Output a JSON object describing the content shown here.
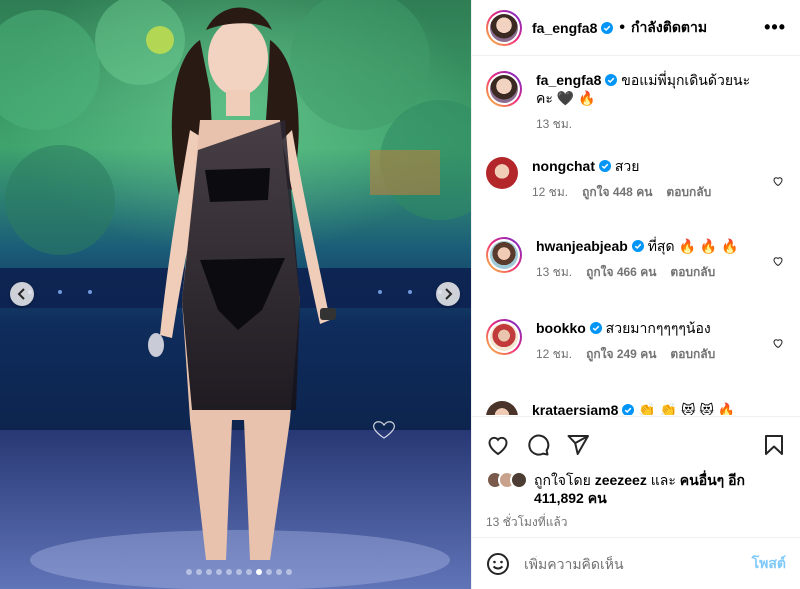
{
  "post_author": {
    "username": "fa_engfa8",
    "follow_status": "กำลังติดตาม",
    "separator": "•"
  },
  "caption": {
    "username": "fa_engfa8",
    "text": "ขอแม่พี่มุกเดินด้วยนะคะ 🖤 🔥",
    "time": "13 ชม."
  },
  "comments": [
    {
      "username": "nongchat",
      "text": "สวย",
      "time": "12 ชม.",
      "likes": "ถูกใจ 448 คน",
      "reply": "ตอบกลับ"
    },
    {
      "username": "hwanjeabjeab",
      "text": "ที่สุด 🔥 🔥 🔥",
      "time": "13 ชม.",
      "likes": "ถูกใจ 466 คน",
      "reply": "ตอบกลับ"
    },
    {
      "username": "bookko",
      "text": "สวยมากๆๆๆๆน้อง",
      "time": "12 ชม.",
      "likes": "ถูกใจ 249 คน",
      "reply": "ตอบกลับ"
    },
    {
      "username": "krataersiam8",
      "text": "👏 👏 😻 😻 🔥"
    }
  ],
  "liked_by": {
    "prefix": "ถูกใจโดย",
    "user": "zeezeez",
    "and": "และ",
    "others": "คนอื่นๆ",
    "more": "อีก",
    "count": "411,892 คน"
  },
  "timestamp": "13 ชั่วโมงที่แล้ว",
  "add_comment": {
    "placeholder": "เพิ่มความคิดเห็น",
    "post_label": "โพสต์"
  },
  "carousel": {
    "total": 11,
    "active_index": 7
  },
  "colors": {
    "verified": "#0095f6",
    "link": "#0095f6",
    "secondary_text": "#737373"
  },
  "icons": [
    "chevron-left-icon",
    "chevron-right-icon",
    "more-icon",
    "heart-icon",
    "comment-icon",
    "share-icon",
    "bookmark-icon",
    "emoji-icon",
    "verified-badge-icon"
  ]
}
